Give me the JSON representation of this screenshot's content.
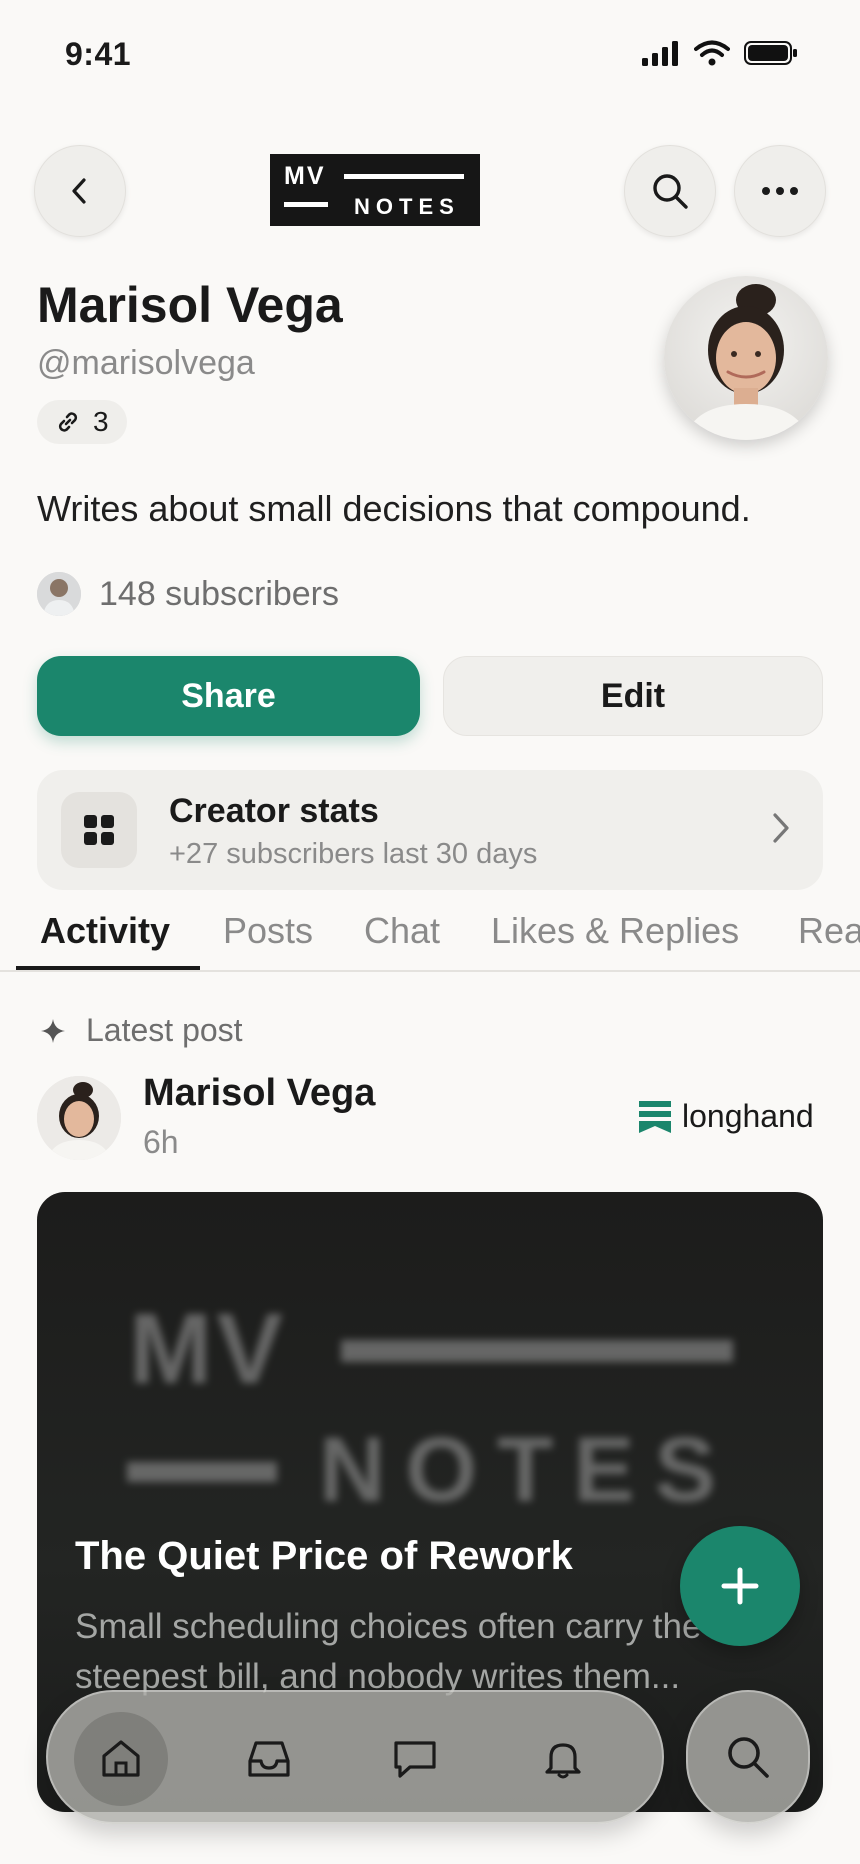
{
  "status_bar": {
    "time": "9:41"
  },
  "header": {
    "logo": {
      "top": "MV",
      "bottom": "NOTES"
    }
  },
  "profile": {
    "name": "Marisol Vega",
    "handle": "@marisolvega",
    "links_count": "3",
    "bio": "Writes about small decisions that compound.",
    "subscribers": "148 subscribers"
  },
  "actions": {
    "share_label": "Share",
    "edit_label": "Edit"
  },
  "stats_card": {
    "title": "Creator stats",
    "subtitle": "+27 subscribers last 30 days"
  },
  "tabs": [
    {
      "label": "Activity",
      "active": true
    },
    {
      "label": "Posts"
    },
    {
      "label": "Chat"
    },
    {
      "label": "Likes & Replies"
    },
    {
      "label": "Rea"
    }
  ],
  "feed": {
    "section_label": "Latest post",
    "post": {
      "author": "Marisol Vega",
      "time": "6h",
      "publication": "longhand",
      "cover": {
        "top": "MV",
        "bottom": "NOTES"
      },
      "title": "The Quiet Price of Rework",
      "excerpt": "Small scheduling choices often carry the steepest bill, and nobody writes them..."
    }
  },
  "bottom_nav": {
    "items": [
      {
        "icon": "home-icon",
        "active": true
      },
      {
        "icon": "inbox-icon"
      },
      {
        "icon": "chat-icon"
      },
      {
        "icon": "bell-icon"
      }
    ],
    "search_icon": "search-icon"
  },
  "colors": {
    "accent": "#1b866c",
    "background": "#faf9f7",
    "text": "#1a1a1a",
    "muted": "#8a8a8a"
  }
}
